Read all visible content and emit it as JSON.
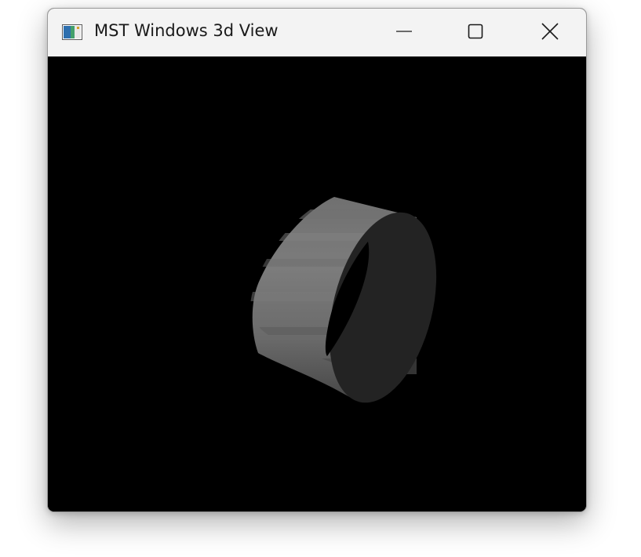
{
  "window": {
    "title": "MST Windows 3d View",
    "icon": "app-window-icon",
    "controls": {
      "minimize_icon": "minimize-icon",
      "maximize_icon": "maximize-icon",
      "close_icon": "close-icon"
    }
  },
  "viewport": {
    "background": "#000000",
    "object": "cylinder-tube",
    "colors": {
      "outer_light": "#7a7a7a",
      "outer_dark": "#4e4e4e",
      "inner_face": "#252525",
      "hole": "#000000"
    }
  }
}
